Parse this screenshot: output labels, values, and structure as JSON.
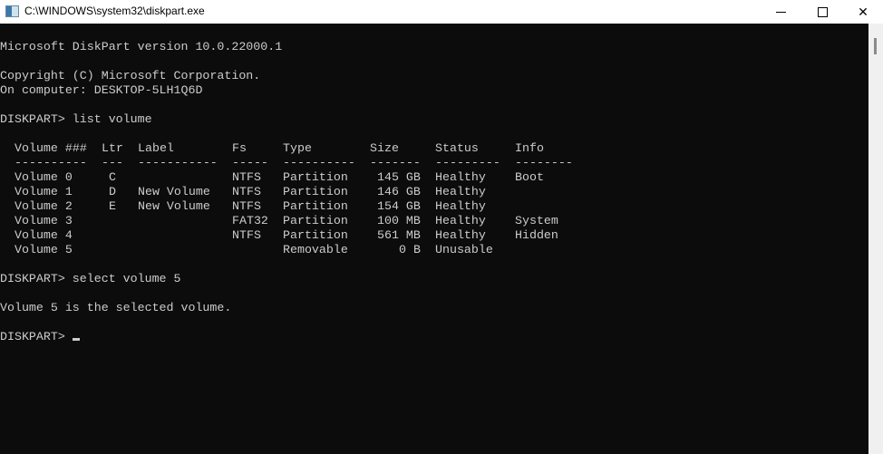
{
  "window": {
    "title": "C:\\WINDOWS\\system32\\diskpart.exe",
    "icon": "console-app-icon",
    "controls": [
      "minimize",
      "maximize",
      "close"
    ]
  },
  "console": {
    "header_lines": [
      "Microsoft DiskPart version 10.0.22000.1",
      "",
      "Copyright (C) Microsoft Corporation.",
      "On computer: DESKTOP-5LH1Q6D",
      "",
      "DISKPART> list volume",
      ""
    ],
    "volume_table": {
      "columns": [
        "Volume ###",
        "Ltr",
        "Label",
        "Fs",
        "Type",
        "Size",
        "Status",
        "Info"
      ],
      "separators": [
        "----------",
        "---",
        "-----------",
        "-----",
        "----------",
        "-------",
        "---------",
        "--------"
      ],
      "rows": [
        [
          "Volume 0",
          "C",
          "",
          "NTFS",
          "Partition",
          "145 GB",
          "Healthy",
          "Boot"
        ],
        [
          "Volume 1",
          "D",
          "New Volume",
          "NTFS",
          "Partition",
          "146 GB",
          "Healthy",
          ""
        ],
        [
          "Volume 2",
          "E",
          "New Volume",
          "NTFS",
          "Partition",
          "154 GB",
          "Healthy",
          ""
        ],
        [
          "Volume 3",
          "",
          "",
          "FAT32",
          "Partition",
          "100 MB",
          "Healthy",
          "System"
        ],
        [
          "Volume 4",
          "",
          "",
          "NTFS",
          "Partition",
          "561 MB",
          "Healthy",
          "Hidden"
        ],
        [
          "Volume 5",
          "",
          "",
          "",
          "Removable",
          "0 B",
          "Unusable",
          ""
        ]
      ]
    },
    "footer_lines": [
      "",
      "DISKPART> select volume 5",
      "",
      "Volume 5 is the selected volume.",
      ""
    ],
    "prompt": "DISKPART> "
  },
  "colors": {
    "console_bg": "#0c0c0c",
    "console_fg": "#cccccc",
    "titlebar_bg": "#ffffff",
    "scrollbar_track": "#f0f0f0"
  }
}
